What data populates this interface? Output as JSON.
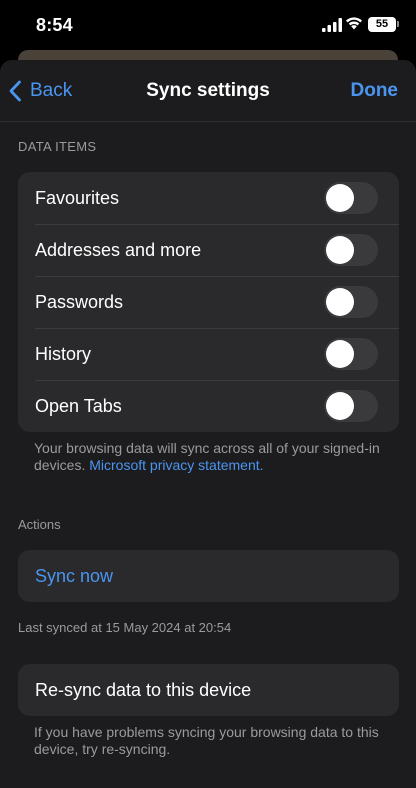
{
  "status_bar": {
    "time": "8:54",
    "battery": "55"
  },
  "nav": {
    "back_label": "Back",
    "title": "Sync settings",
    "done_label": "Done"
  },
  "data_items": {
    "header": "DATA ITEMS",
    "items": [
      {
        "label": "Favourites",
        "enabled": false
      },
      {
        "label": "Addresses and more",
        "enabled": false
      },
      {
        "label": "Passwords",
        "enabled": false
      },
      {
        "label": "History",
        "enabled": false
      },
      {
        "label": "Open Tabs",
        "enabled": false
      }
    ],
    "footnote_text": "Your browsing data will sync across all of your signed-in devices.",
    "footnote_link": "Microsoft privacy statement."
  },
  "actions": {
    "header": "Actions",
    "sync_now_label": "Sync now",
    "last_synced": "Last synced at 15 May 2024 at 20:54",
    "resync_label": "Re-sync data to this device",
    "resync_footnote": "If you have problems syncing your browsing data to this device, try re-syncing."
  },
  "colors": {
    "accent": "#4a95f0",
    "background": "#000000",
    "sheet": "#1c1c1e",
    "group": "#2a2a2c",
    "secondary_text": "#9a9a9f",
    "toggle_off": "#3a3a3d"
  }
}
